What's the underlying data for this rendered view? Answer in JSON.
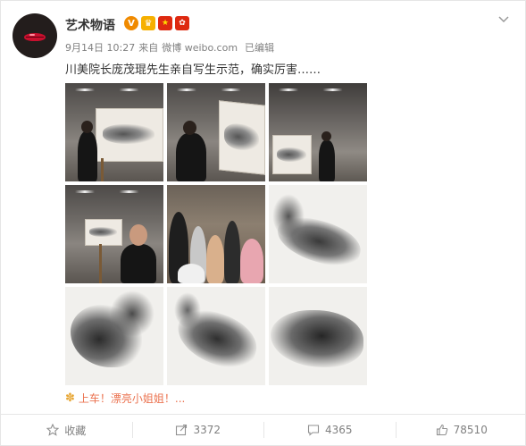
{
  "post": {
    "author": "艺术物语",
    "badges": [
      {
        "name": "verified-badge",
        "text": "V",
        "color": "#f08a00"
      },
      {
        "name": "vip-crown-badge",
        "text": "♛",
        "color": "#f6b000"
      },
      {
        "name": "china-flag-badge",
        "text": "★",
        "color": "#de2910"
      },
      {
        "name": "hongkong-flag-badge",
        "text": "✿",
        "color": "#de2910"
      }
    ],
    "date": "9月14日 10:27",
    "via_prefix": "来自",
    "source": "微博 weibo.com",
    "edited": "已编辑",
    "text": "川美院长庞茂琨先生亲自写生示范，确实厉害……",
    "dropdown_icon": "chevron-down-icon"
  },
  "photos": [
    {
      "name": "photo-1-studio-demo",
      "kind": "studio"
    },
    {
      "name": "photo-2-studio-demo",
      "kind": "studio"
    },
    {
      "name": "photo-3-studio-demo",
      "kind": "studio"
    },
    {
      "name": "photo-4-presenting",
      "kind": "studio"
    },
    {
      "name": "photo-5-audience",
      "kind": "crowd"
    },
    {
      "name": "photo-6-drawing",
      "kind": "drawing"
    },
    {
      "name": "photo-7-drawing",
      "kind": "drawing"
    },
    {
      "name": "photo-8-drawing",
      "kind": "drawing"
    },
    {
      "name": "photo-9-drawing",
      "kind": "drawing"
    }
  ],
  "repost_hint": {
    "icon": "flower-icon",
    "text": "上车！漂亮小姐姐！...",
    "color": "#eb7350"
  },
  "actions": {
    "favorite": {
      "icon": "star-icon",
      "label": "收藏"
    },
    "repost": {
      "icon": "share-icon",
      "label": "3372"
    },
    "comment": {
      "icon": "comment-icon",
      "label": "4365"
    },
    "like": {
      "icon": "thumbs-up-icon",
      "label": "78510"
    }
  }
}
